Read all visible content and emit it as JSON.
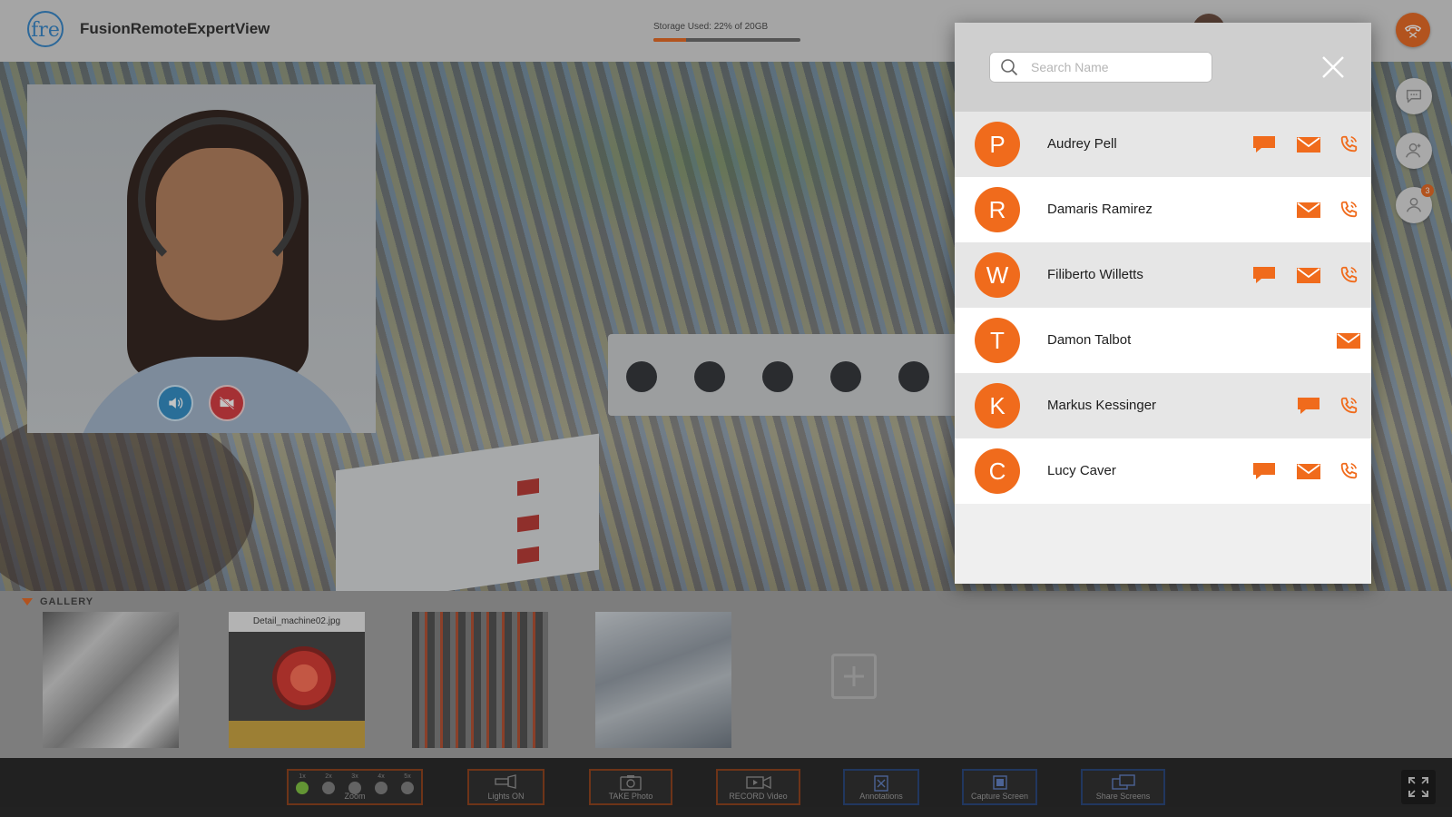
{
  "header": {
    "logo_text": "fre",
    "app_title": "FusionRemoteExpertView",
    "storage_label": "Storage Used: 22% of 20GB",
    "storage_fraction": 0.22
  },
  "pip": {
    "speaker_icon": "speaker-icon",
    "camera_off_icon": "camera-off-icon"
  },
  "rail": {
    "chat_icon": "chat-bubble-icon",
    "add_user_icon": "add-user-icon",
    "participants_icon": "participants-icon",
    "participants_badge": "3"
  },
  "contacts_panel": {
    "search_placeholder": "Search Name",
    "close_icon": "close-icon",
    "accent_color": "#f06b1c",
    "contacts": [
      {
        "initial": "P",
        "name": "Audrey Pell",
        "actions": [
          "chat",
          "email",
          "call"
        ]
      },
      {
        "initial": "R",
        "name": "Damaris Ramirez",
        "actions": [
          "email",
          "call"
        ]
      },
      {
        "initial": "W",
        "name": "Filiberto Willetts",
        "actions": [
          "chat",
          "email",
          "call"
        ]
      },
      {
        "initial": "T",
        "name": "Damon Talbot",
        "actions": [
          "email"
        ]
      },
      {
        "initial": "K",
        "name": "Markus Kessinger",
        "actions": [
          "chat",
          "call"
        ]
      },
      {
        "initial": "C",
        "name": "Lucy Caver",
        "actions": [
          "chat",
          "email",
          "call"
        ]
      }
    ]
  },
  "gallery": {
    "title": "GALLERY",
    "items": [
      {
        "caption": ""
      },
      {
        "caption": "Detail_machine02.jpg"
      },
      {
        "caption": ""
      },
      {
        "caption": ""
      }
    ],
    "add_icon": "plus-icon"
  },
  "toolbar": {
    "zoom": {
      "label": "Zoom",
      "steps": [
        "1x",
        "2x",
        "3x",
        "4x",
        "5x"
      ],
      "active_step": "1x"
    },
    "lights_label": "Lights ON",
    "photo_label": "TAKE Photo",
    "record_label": "RECORD Video",
    "annotations_label": "Annotations",
    "capture_label": "Capture Screen",
    "share_label": "Share Screens",
    "fullscreen_icon": "fullscreen-icon"
  }
}
